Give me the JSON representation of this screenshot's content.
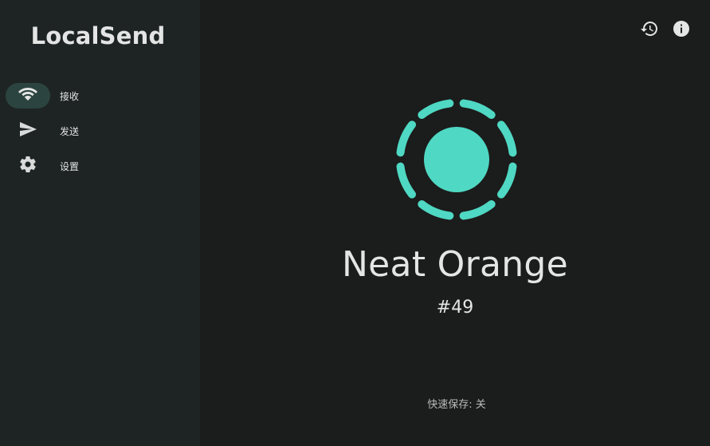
{
  "app": {
    "title": "LocalSend"
  },
  "sidebar": {
    "items": [
      {
        "label": "接收",
        "icon": "wifi-icon",
        "active": true
      },
      {
        "label": "发送",
        "icon": "send-icon",
        "active": false
      },
      {
        "label": "设置",
        "icon": "gear-icon",
        "active": false
      }
    ]
  },
  "header": {
    "icons": [
      "history-icon",
      "info-icon"
    ]
  },
  "main": {
    "device_name": "Neat Orange",
    "device_id": "#49",
    "quick_save": "快速保存: 关"
  },
  "colors": {
    "accent": "#4fd8c3",
    "sidebar_bg": "#1e2424",
    "main_bg": "#1b1c1c",
    "active_pill": "#2c4440"
  }
}
